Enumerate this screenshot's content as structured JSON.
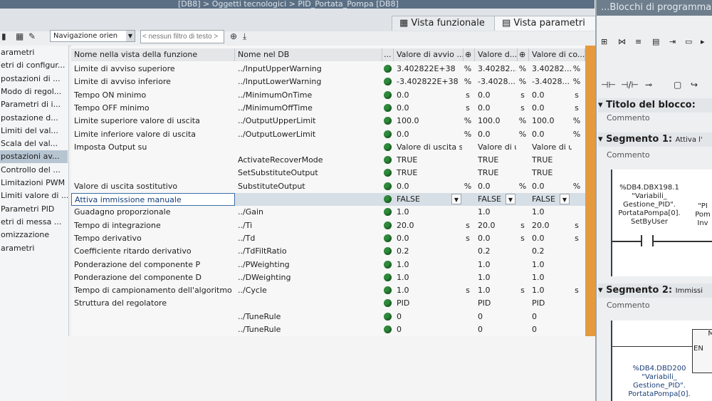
{
  "window": {
    "title": "[DB8] > Oggetti tecnologici > PID_Portata_Pompa [DB8]",
    "right_title": "...Blocchi di programma"
  },
  "view_tabs": {
    "functional": "Vista funzionale",
    "parameters": "Vista parametri"
  },
  "toolbar": {
    "navigation_select": "Navigazione orien",
    "filter_placeholder": "< nessun filtro di testo >"
  },
  "left_nav": {
    "items": [
      "arametri",
      "etri di configur...",
      "postazioni di ...",
      "Modo di regol...",
      "Parametri di i...",
      "postazione d...",
      "Limiti del val...",
      "Scala del val...",
      "postazioni av...",
      "Controllo del ...",
      "Limitazioni PWM",
      "Limiti valore di ...",
      "Parametri PID",
      "etri di messa ...",
      "omizzazione",
      "arametri"
    ],
    "selected_index": 8
  },
  "grid": {
    "headers": [
      "Nome nella vista della funzione",
      "Nome nel DB",
      "...",
      "Valore di avvio ...",
      "Valore d...",
      "Valore di co..."
    ],
    "rows": [
      {
        "name": "Limite di avviso superiore",
        "db": "../InputUpperWarning",
        "av": "3.402822E+38",
        "u1": "%",
        "vd": "3.40282...",
        "u2": "%",
        "vc": "3.40282...",
        "u3": "%"
      },
      {
        "name": "Limite di avviso inferiore",
        "db": "../InputLowerWarning",
        "av": "-3.402822E+38",
        "u1": "%",
        "vd": "-3.4028...",
        "u2": "%",
        "vc": "-3.4028...",
        "u3": "%"
      },
      {
        "name": "Tempo ON minimo",
        "db": "../MinimumOnTime",
        "av": "0.0",
        "u1": "s",
        "vd": "0.0",
        "u2": "s",
        "vc": "0.0",
        "u3": "s"
      },
      {
        "name": "Tempo OFF minimo",
        "db": "../MinimumOffTime",
        "av": "0.0",
        "u1": "s",
        "vd": "0.0",
        "u2": "s",
        "vc": "0.0",
        "u3": "s"
      },
      {
        "name": "Limite superiore valore di uscita",
        "db": "../OutputUpperLimit",
        "av": "100.0",
        "u1": "%",
        "vd": "100.0",
        "u2": "%",
        "vc": "100.0",
        "u3": "%"
      },
      {
        "name": "Limite inferiore valore di uscita",
        "db": "../OutputLowerLimit",
        "av": "0.0",
        "u1": "%",
        "vd": "0.0",
        "u2": "%",
        "vc": "0.0",
        "u3": "%"
      },
      {
        "name": "Imposta Output su",
        "db": "",
        "av": "Valore di uscita sos...",
        "u1": "",
        "vd": "Valore di us...",
        "u2": "",
        "vc": "Valore di us...",
        "u3": ""
      },
      {
        "name": "",
        "db": "ActivateRecoverMode",
        "av": "TRUE",
        "u1": "",
        "vd": "TRUE",
        "u2": "",
        "vc": "TRUE",
        "u3": ""
      },
      {
        "name": "",
        "db": "SetSubstituteOutput",
        "av": "TRUE",
        "u1": "",
        "vd": "TRUE",
        "u2": "",
        "vc": "TRUE",
        "u3": ""
      },
      {
        "name": "Valore di uscita sostitutivo",
        "db": "SubstituteOutput",
        "av": "0.0",
        "u1": "%",
        "vd": "0.0",
        "u2": "%",
        "vc": "0.0",
        "u3": "%"
      },
      {
        "name": "Attiva immissione manuale",
        "db": "",
        "av": "FALSE",
        "u1": "",
        "vd": "FALSE",
        "u2": "",
        "vc": "FALSE",
        "u3": ""
      },
      {
        "name": "Guadagno proporzionale",
        "db": "../Gain",
        "av": "1.0",
        "u1": "",
        "vd": "1.0",
        "u2": "",
        "vc": "1.0",
        "u3": ""
      },
      {
        "name": "Tempo di integrazione",
        "db": "../Ti",
        "av": "20.0",
        "u1": "s",
        "vd": "20.0",
        "u2": "s",
        "vc": "20.0",
        "u3": "s"
      },
      {
        "name": "Tempo derivativo",
        "db": "../Td",
        "av": "0.0",
        "u1": "s",
        "vd": "0.0",
        "u2": "s",
        "vc": "0.0",
        "u3": "s"
      },
      {
        "name": "Coefficiente ritardo derivativo",
        "db": "../TdFiltRatio",
        "av": "0.2",
        "u1": "",
        "vd": "0.2",
        "u2": "",
        "vc": "0.2",
        "u3": ""
      },
      {
        "name": "Ponderazione del componente P",
        "db": "../PWeighting",
        "av": "1.0",
        "u1": "",
        "vd": "1.0",
        "u2": "",
        "vc": "1.0",
        "u3": ""
      },
      {
        "name": "Ponderazione del componente D",
        "db": "../DWeighting",
        "av": "1.0",
        "u1": "",
        "vd": "1.0",
        "u2": "",
        "vc": "1.0",
        "u3": ""
      },
      {
        "name": "Tempo di campionamento dell'algoritmo ...",
        "db": "../Cycle",
        "av": "1.0",
        "u1": "s",
        "vd": "1.0",
        "u2": "s",
        "vc": "1.0",
        "u3": "s"
      },
      {
        "name": "Struttura del regolatore",
        "db": "",
        "av": "PID",
        "u1": "",
        "vd": "PID",
        "u2": "",
        "vc": "PID",
        "u3": ""
      },
      {
        "name": "",
        "db": "../TuneRule",
        "av": "0",
        "u1": "",
        "vd": "0",
        "u2": "",
        "vc": "0",
        "u3": ""
      },
      {
        "name": "",
        "db": "../TuneRule",
        "av": "0",
        "u1": "",
        "vd": "0",
        "u2": "",
        "vc": "0",
        "u3": ""
      }
    ]
  },
  "right_panel": {
    "title_label": "Titolo del blocco:",
    "comment": "Commento",
    "segment1": "Segmento 1:",
    "segment1_extra": "Attiva l'",
    "segment2": "Segmento 2:",
    "segment2_extra": "Immissi",
    "contact1_lines": [
      "%DB4.DBX198.1",
      "\"Variabili_",
      "Gestione_PID\".",
      "PortataPompa[0].",
      "SetByUser"
    ],
    "contact1_side": [
      "\"PI",
      "Pom",
      "Inv"
    ],
    "contact2_lines": [
      "%DB4.DBD200",
      "\"Variabili_",
      "Gestione_PID\".",
      "PortataPompa[0]."
    ],
    "en_label": "EN",
    "box_label": "M"
  }
}
